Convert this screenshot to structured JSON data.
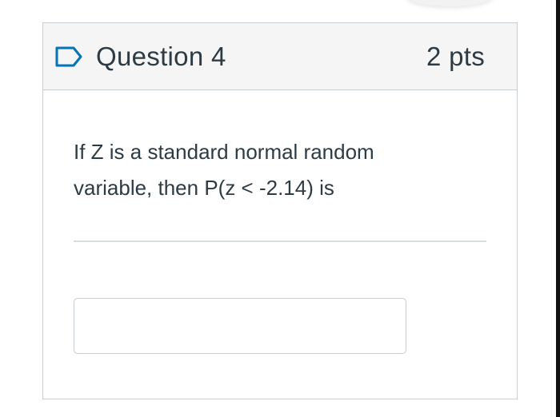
{
  "question": {
    "title": "Question 4",
    "points": "2 pts",
    "flag_icon": "bookmark-flag-icon",
    "text": "If Z is a standard normal random variable, then P(z < -2.14) is",
    "answer_value": "",
    "answer_placeholder": ""
  },
  "colors": {
    "header_background": "#f5f5f5",
    "border": "#c7cdd1",
    "text": "#2d3b45",
    "flag": "#0374b5"
  }
}
